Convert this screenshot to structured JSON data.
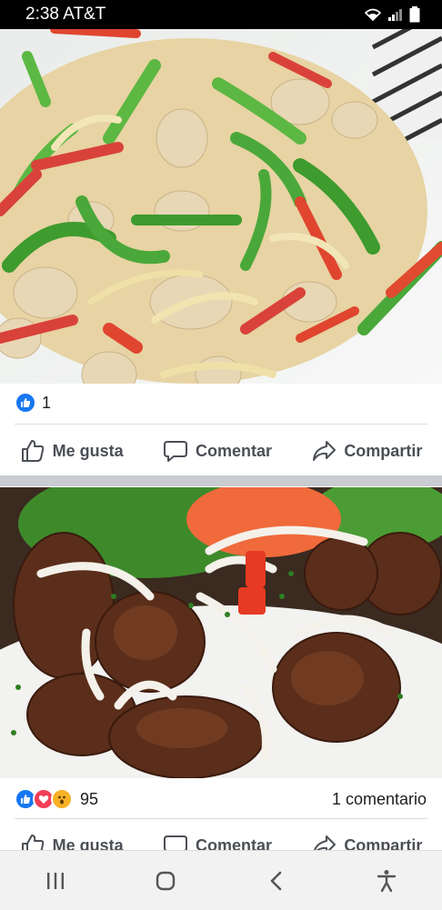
{
  "status_bar": {
    "time_carrier": "2:38 AT&T"
  },
  "posts": [
    {
      "image_label": "chicken fajitas with peppers and onions",
      "reaction_count": "1",
      "actions": {
        "like": "Me gusta",
        "comment": "Comentar",
        "share": "Compartir"
      }
    },
    {
      "image_label": "fried pork chunks with onions",
      "reaction_count": "95",
      "comment_count": "1 comentario",
      "actions": {
        "like": "Me gusta",
        "comment": "Comentar",
        "share": "Compartir"
      }
    }
  ],
  "colors": {
    "like_blue": "#1877f2",
    "love_red": "#f33e58",
    "haha_yellow": "#f7b125",
    "action_gray": "#4b4f56"
  },
  "nav": {
    "icons": [
      "recent-apps-icon",
      "home-icon",
      "back-icon",
      "accessibility-icon"
    ]
  }
}
